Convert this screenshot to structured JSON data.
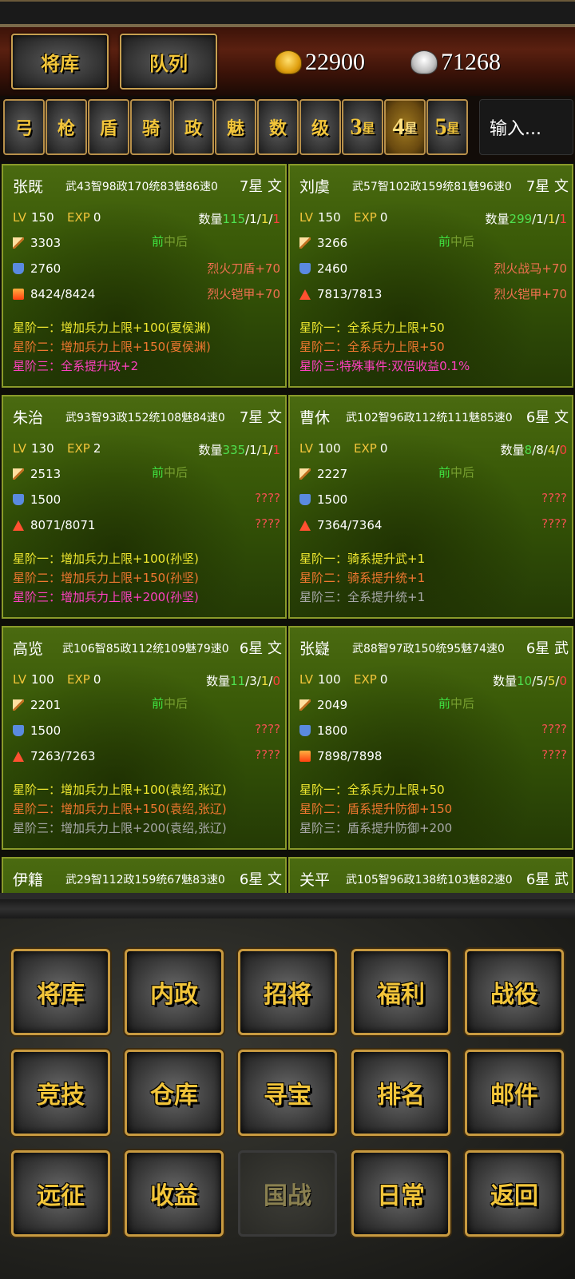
{
  "header": {
    "tab_generals": "将库",
    "tab_formation": "队列",
    "gold": "22900",
    "silver": "71268"
  },
  "filters": {
    "buttons": [
      "弓",
      "枪",
      "盾",
      "骑",
      "政",
      "魅",
      "数",
      "级"
    ],
    "stars": [
      {
        "num": "3",
        "unit": "星"
      },
      {
        "num": "4",
        "unit": "星"
      },
      {
        "num": "5",
        "unit": "星"
      }
    ],
    "search_placeholder": "输入..."
  },
  "labels": {
    "lv": "LV",
    "exp": "EXP",
    "qty": "数量",
    "pos_front": "前",
    "pos_rest": "中后",
    "unknown": "????"
  },
  "cards": [
    {
      "name": "张既",
      "stats": "武43智98政170统83魅86速0",
      "rank": "7星 文",
      "lv": "150",
      "exp": "0",
      "qty": {
        "a": "115",
        "b": "1",
        "c": "1",
        "d": "1"
      },
      "atk": "3303",
      "def": "2760",
      "hp": "8424/8424",
      "equip1": "烈火刀盾+70",
      "equip2": "烈火铠甲+70",
      "skills": [
        "星阶一：增加兵力上限+100(夏侯渊)",
        "星阶二：增加兵力上限+150(夏侯渊)",
        "星阶三：全系提升政+2"
      ]
    },
    {
      "name": "刘虞",
      "stats": "武57智102政159统81魅96速0",
      "rank": "7星 文",
      "lv": "150",
      "exp": "0",
      "qty": {
        "a": "299",
        "b": "1",
        "c": "1",
        "d": "1"
      },
      "atk": "3266",
      "def": "2460",
      "hp": "7813/7813",
      "equip1": "烈火战马+70",
      "equip2": "烈火铠甲+70",
      "skills": [
        "星阶一：全系兵力上限+50",
        "星阶二：全系兵力上限+50",
        "星阶三:特殊事件:双倍收益0.1%"
      ]
    },
    {
      "name": "朱治",
      "stats": "武93智93政152统108魅84速0",
      "rank": "7星 文",
      "lv": "130",
      "exp": "2",
      "qty": {
        "a": "335",
        "b": "1",
        "c": "1",
        "d": "1"
      },
      "atk": "2513",
      "def": "1500",
      "hp": "8071/8071",
      "skills": [
        "星阶一：增加兵力上限+100(孙坚)",
        "星阶二：增加兵力上限+150(孙坚)",
        "星阶三：增加兵力上限+200(孙坚)"
      ]
    },
    {
      "name": "曹休",
      "stats": "武102智96政112统111魅85速0",
      "rank": "6星 文",
      "lv": "100",
      "exp": "0",
      "qty": {
        "a": "8",
        "b": "8",
        "c": "4",
        "d": "0"
      },
      "atk": "2227",
      "def": "1500",
      "hp": "7364/7364",
      "skills": [
        "星阶一：骑系提升武+1",
        "星阶二：骑系提升统+1",
        "星阶三：全系提升统+1"
      ]
    },
    {
      "name": "高览",
      "stats": "武106智85政112统109魅79速0",
      "rank": "6星 文",
      "lv": "100",
      "exp": "0",
      "qty": {
        "a": "11",
        "b": "3",
        "c": "1",
        "d": "0"
      },
      "atk": "2201",
      "def": "1500",
      "hp": "7263/7263",
      "skills": [
        "星阶一：增加兵力上限+100(袁绍,张辽)",
        "星阶二：增加兵力上限+150(袁绍,张辽)",
        "星阶三：增加兵力上限+200(袁绍,张辽)"
      ]
    },
    {
      "name": "张嶷",
      "stats": "武88智97政150统95魅74速0",
      "rank": "6星 武",
      "lv": "100",
      "exp": "0",
      "qty": {
        "a": "10",
        "b": "5",
        "c": "5",
        "d": "0"
      },
      "atk": "2049",
      "def": "1800",
      "hp": "7898/7898",
      "skills": [
        "星阶一：全系兵力上限+50",
        "星阶二：盾系提升防御+150",
        "星阶三：盾系提升防御+200"
      ]
    },
    {
      "name": "伊籍",
      "stats": "武29智112政159统67魅83速0",
      "rank": "6星 文"
    },
    {
      "name": "关平",
      "stats": "武105智96政138统103魅82速0",
      "rank": "6星 武"
    }
  ],
  "menu": [
    "将库",
    "内政",
    "招将",
    "福利",
    "战役",
    "竞技",
    "仓库",
    "寻宝",
    "排名",
    "邮件",
    "远征",
    "收益",
    "国战",
    "日常",
    "返回"
  ]
}
